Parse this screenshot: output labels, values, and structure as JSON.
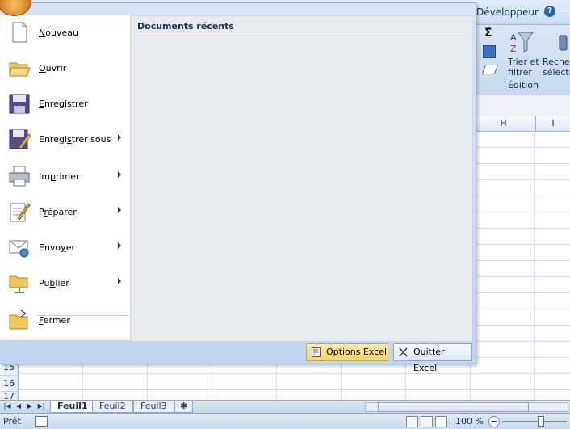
{
  "ribbon": {
    "tab_developer": "Développeur",
    "help": "?",
    "sigma": "Σ",
    "sort_filter_line1": "Trier et",
    "sort_filter_line2": "filtrer",
    "find_line1": "Recher",
    "find_line2": "sélecti",
    "group_label": "Édition"
  },
  "sheet": {
    "col_headers": [
      "H",
      "I"
    ],
    "row_headers": [
      "15",
      "16",
      "17"
    ]
  },
  "office_menu": {
    "items": [
      {
        "label": "Nouveau",
        "u": "N",
        "submenu": false
      },
      {
        "label": "Ouvrir",
        "u": "O",
        "submenu": false
      },
      {
        "label": "Enregistrer",
        "u": "E",
        "submenu": false
      },
      {
        "label": "Enregistrer sous",
        "u": "s",
        "submenu": true
      },
      {
        "label": "Imprimer",
        "u": "p",
        "submenu": true
      },
      {
        "label": "Préparer",
        "u": "r",
        "submenu": true
      },
      {
        "label": "Envoyer",
        "u": "y",
        "submenu": true
      },
      {
        "label": "Publier",
        "u": "b",
        "submenu": true
      },
      {
        "label": "Fermer",
        "u": "F",
        "submenu": false
      }
    ],
    "recent_title": "Documents récents",
    "options_button": "Options Excel",
    "quit_button": "Quitter Excel"
  },
  "sheet_tabs": [
    "Feuil1",
    "Feuil2",
    "Feuil3"
  ],
  "status": {
    "ready": "Prêt",
    "zoom": "100 %"
  }
}
